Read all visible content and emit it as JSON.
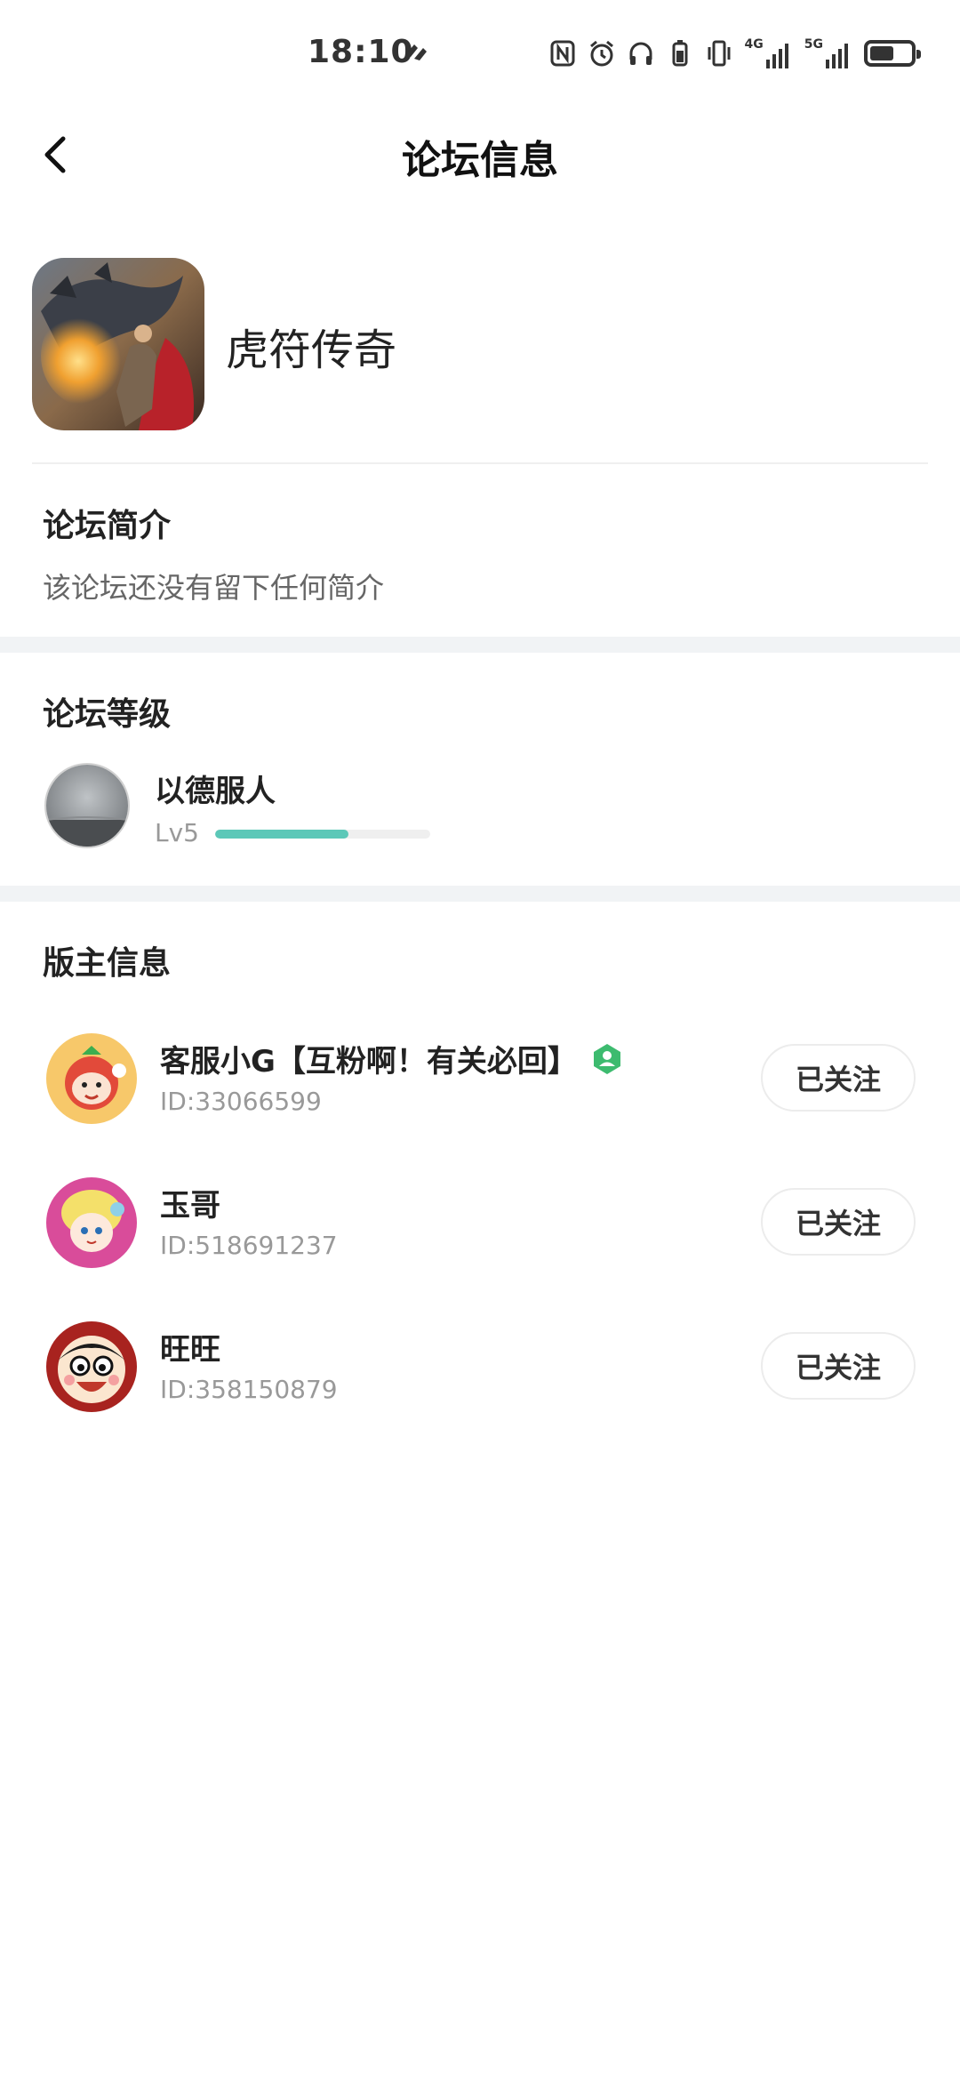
{
  "status_bar": {
    "time": "18:10",
    "net_4g": "4G",
    "net_5g": "5G",
    "icons": [
      "sync-icon",
      "nfc-icon",
      "alarm-icon",
      "headphones-icon",
      "battery-saver-icon",
      "vibrate-icon",
      "signal-4g-icon",
      "signal-5g-icon",
      "battery-icon"
    ]
  },
  "header": {
    "title": "论坛信息",
    "back_icon": "back-arrow-icon"
  },
  "forum": {
    "name": "虎符传奇"
  },
  "intro": {
    "title": "论坛简介",
    "text": "该论坛还没有留下任何简介"
  },
  "level": {
    "title": "论坛等级",
    "name": "以德服人",
    "lv": "Lv5",
    "progress": 0.62
  },
  "moderators": {
    "title": "版主信息",
    "items": [
      {
        "name": "客服小G【互粉啊！有关必回】",
        "id": "ID:33066599",
        "follow_label": "已关注",
        "badge": "moderator-badge-icon"
      },
      {
        "name": "玉哥",
        "id": "ID:518691237",
        "follow_label": "已关注"
      },
      {
        "name": "旺旺",
        "id": "ID:358150879",
        "follow_label": "已关注"
      }
    ]
  },
  "colors": {
    "accent": "#5cc8b8",
    "badge_green": "#3dbb6f",
    "section_gap": "#f1f3f5",
    "muted_text": "#999999"
  }
}
